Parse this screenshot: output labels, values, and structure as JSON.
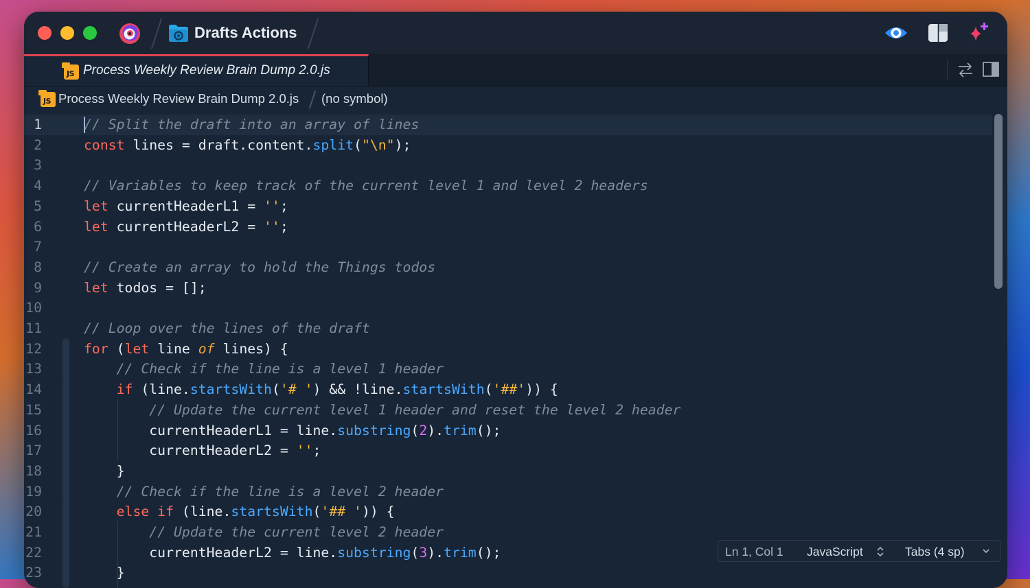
{
  "window": {
    "title": "Drafts Actions",
    "app_icon": "drafts-app-icon",
    "folder_icon": "gear-folder-icon",
    "toolbar_icons": [
      "preview-eye-icon",
      "layout-panel-icon",
      "sparkle-plus-icon"
    ]
  },
  "tab": {
    "title": "Process Weekly Review Brain Dump 2.0.js",
    "icon": "js-file-icon",
    "actions": [
      "swap-arrows-icon",
      "split-view-icon"
    ]
  },
  "breadcrumb": {
    "file": "Process Weekly Review Brain Dump 2.0.js",
    "symbol": "(no symbol)"
  },
  "editor": {
    "lines": [
      {
        "n": "1",
        "tokens": [
          [
            "cm",
            "// Split the draft into an array of lines"
          ]
        ]
      },
      {
        "n": "2",
        "tokens": [
          [
            "kw",
            "const"
          ],
          [
            "",
            " lines = draft.content."
          ],
          [
            "fn",
            "split"
          ],
          [
            "",
            "("
          ],
          [
            "st",
            "\"\\n\""
          ],
          [
            "",
            ");"
          ]
        ]
      },
      {
        "n": "3",
        "tokens": []
      },
      {
        "n": "4",
        "tokens": [
          [
            "cm",
            "// Variables to keep track of the current level 1 and level 2 headers"
          ]
        ]
      },
      {
        "n": "5",
        "tokens": [
          [
            "kw",
            "let"
          ],
          [
            "",
            " currentHeaderL1 = "
          ],
          [
            "st",
            "''"
          ],
          [
            "",
            ";"
          ]
        ]
      },
      {
        "n": "6",
        "tokens": [
          [
            "kw",
            "let"
          ],
          [
            "",
            " currentHeaderL2 = "
          ],
          [
            "st",
            "''"
          ],
          [
            "",
            ";"
          ]
        ]
      },
      {
        "n": "7",
        "tokens": []
      },
      {
        "n": "8",
        "tokens": [
          [
            "cm",
            "// Create an array to hold the Things todos"
          ]
        ]
      },
      {
        "n": "9",
        "tokens": [
          [
            "kw",
            "let"
          ],
          [
            "",
            " todos = [];"
          ]
        ]
      },
      {
        "n": "10",
        "tokens": []
      },
      {
        "n": "11",
        "tokens": [
          [
            "cm",
            "// Loop over the lines of the draft"
          ]
        ]
      },
      {
        "n": "12",
        "tokens": [
          [
            "kw",
            "for"
          ],
          [
            "",
            " ("
          ],
          [
            "kw",
            "let"
          ],
          [
            "",
            " line "
          ],
          [
            "kwi",
            "of"
          ],
          [
            "",
            " lines) {"
          ]
        ]
      },
      {
        "n": "13",
        "tokens": [
          [
            "",
            "    "
          ],
          [
            "cm",
            "// Check if the line is a level 1 header"
          ]
        ]
      },
      {
        "n": "14",
        "tokens": [
          [
            "",
            "    "
          ],
          [
            "kw",
            "if"
          ],
          [
            "",
            " (line."
          ],
          [
            "fn",
            "startsWith"
          ],
          [
            "",
            "("
          ],
          [
            "st",
            "'# '"
          ],
          [
            "",
            ") && !line."
          ],
          [
            "fn",
            "startsWith"
          ],
          [
            "",
            "("
          ],
          [
            "st",
            "'##'"
          ],
          [
            "",
            ")) {"
          ]
        ]
      },
      {
        "n": "15",
        "tokens": [
          [
            "",
            "        "
          ],
          [
            "cm",
            "// Update the current level 1 header and reset the level 2 header"
          ]
        ]
      },
      {
        "n": "16",
        "tokens": [
          [
            "",
            "        currentHeaderL1 = line."
          ],
          [
            "fn",
            "substring"
          ],
          [
            "",
            "("
          ],
          [
            "nm",
            "2"
          ],
          [
            "",
            ")."
          ],
          [
            "fn",
            "trim"
          ],
          [
            "",
            "();"
          ]
        ]
      },
      {
        "n": "17",
        "tokens": [
          [
            "",
            "        currentHeaderL2 = "
          ],
          [
            "st",
            "''"
          ],
          [
            "",
            ";"
          ]
        ]
      },
      {
        "n": "18",
        "tokens": [
          [
            "",
            "    }"
          ]
        ]
      },
      {
        "n": "19",
        "tokens": [
          [
            "",
            "    "
          ],
          [
            "cm",
            "// Check if the line is a level 2 header"
          ]
        ]
      },
      {
        "n": "20",
        "tokens": [
          [
            "",
            "    "
          ],
          [
            "kw",
            "else if"
          ],
          [
            "",
            " (line."
          ],
          [
            "fn",
            "startsWith"
          ],
          [
            "",
            "("
          ],
          [
            "st",
            "'## '"
          ],
          [
            "",
            ")) {"
          ]
        ]
      },
      {
        "n": "21",
        "tokens": [
          [
            "",
            "        "
          ],
          [
            "cm",
            "// Update the current level 2 header"
          ]
        ]
      },
      {
        "n": "22",
        "tokens": [
          [
            "",
            "        currentHeaderL2 = line."
          ],
          [
            "fn",
            "substring"
          ],
          [
            "",
            "("
          ],
          [
            "nm",
            "3"
          ],
          [
            "",
            ")."
          ],
          [
            "fn",
            "trim"
          ],
          [
            "",
            "();"
          ]
        ]
      },
      {
        "n": "23",
        "tokens": [
          [
            "",
            "    }"
          ]
        ]
      }
    ]
  },
  "status": {
    "position": "Ln 1, Col 1",
    "language": "JavaScript",
    "indent": "Tabs (4 sp)"
  },
  "colors": {
    "keyword": "#ff6b5b",
    "function": "#4aa8ff",
    "string": "#f6b83e",
    "number": "#d86cf0",
    "comment": "#7f8b99",
    "tab_accent": "#e0444e"
  }
}
